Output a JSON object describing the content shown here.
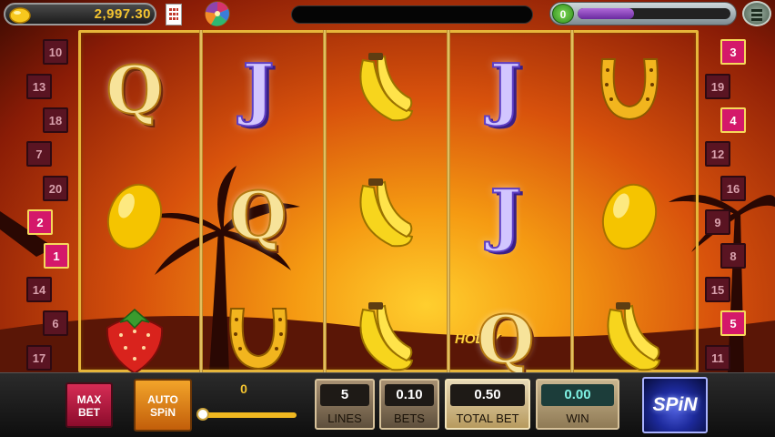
{
  "header": {
    "coins": "2,997.30",
    "level": "0",
    "xp_progress": 0.37
  },
  "reels": [
    [
      "Q",
      "lemon",
      "strawberry"
    ],
    [
      "J",
      "Q",
      "horseshoe"
    ],
    [
      "banana",
      "banana",
      "banana"
    ],
    [
      "J",
      "J",
      "Q"
    ],
    [
      "horseshoe",
      "lemon",
      "banana"
    ]
  ],
  "paylines_left": [
    {
      "n": "10",
      "active": false
    },
    {
      "n": "13",
      "active": false
    },
    {
      "n": "18",
      "active": false
    },
    {
      "n": "7",
      "active": false
    },
    {
      "n": "20",
      "active": false
    },
    {
      "n": "2",
      "active": true
    },
    {
      "n": "1",
      "active": true
    },
    {
      "n": "14",
      "active": false
    },
    {
      "n": "6",
      "active": false
    },
    {
      "n": "17",
      "active": false
    }
  ],
  "paylines_right": [
    {
      "n": "3",
      "active": true
    },
    {
      "n": "19",
      "active": false
    },
    {
      "n": "4",
      "active": true
    },
    {
      "n": "12",
      "active": false
    },
    {
      "n": "16",
      "active": false
    },
    {
      "n": "9",
      "active": false
    },
    {
      "n": "8",
      "active": false
    },
    {
      "n": "15",
      "active": false
    },
    {
      "n": "5",
      "active": true
    },
    {
      "n": "11",
      "active": false
    }
  ],
  "background_sign": "HOLLY",
  "controls": {
    "max_bet_line1": "MAX",
    "max_bet_line2": "BET",
    "auto_spin_line1": "AUTO",
    "auto_spin_line2": "SPiN",
    "slider_value": "0",
    "lines_value": "5",
    "lines_label": "LINES",
    "bets_value": "0.10",
    "bets_label": "BETS",
    "total_bet_value": "0.50",
    "total_bet_label": "TOTAL BET",
    "win_value": "0.00",
    "win_label": "WIN",
    "spin_label": "SPiN"
  },
  "colors": {
    "gold": "#e6b53a",
    "payline_active": "#d4186a",
    "payline_inactive": "#5a1422"
  }
}
